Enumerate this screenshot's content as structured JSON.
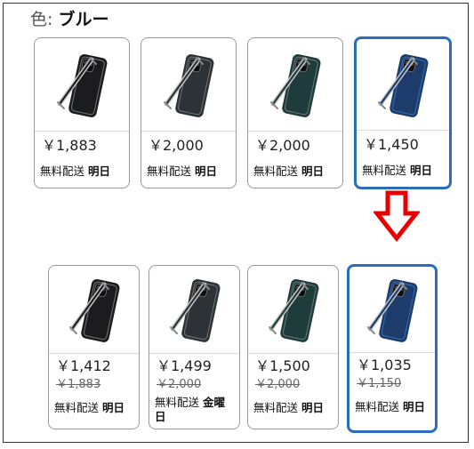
{
  "color_label": {
    "key": "色:",
    "value": "ブルー"
  },
  "phone_colors": {
    "black": "#1c1c1e",
    "graphite": "#2c3236",
    "teal": "#1f3c3d",
    "blue": "#1d3b6b",
    "blue_bright": "#2f6fb5"
  },
  "selected_border_color": "#2a6ebb",
  "arrow": {
    "icon": "down-arrow-icon",
    "color": "#e60000"
  },
  "top_row": [
    {
      "variant": "black",
      "price": "￥1,883",
      "ship_text": "無料配送",
      "ship_day": "明日"
    },
    {
      "variant": "graphite",
      "price": "￥2,000",
      "ship_text": "無料配送",
      "ship_day": "明日"
    },
    {
      "variant": "teal",
      "price": "￥2,000",
      "ship_text": "無料配送",
      "ship_day": "明日"
    },
    {
      "variant": "blue",
      "price": "￥1,450",
      "ship_text": "無料配送",
      "ship_day": "明日",
      "selected": true
    }
  ],
  "bottom_row": [
    {
      "variant": "black",
      "price": "￥1,412",
      "was": "￥1,883",
      "ship_text": "無料配送",
      "ship_day": "明日"
    },
    {
      "variant": "graphite",
      "price": "￥1,499",
      "was": "￥2,000",
      "ship_text": "無料配送",
      "ship_day": "金曜日"
    },
    {
      "variant": "teal",
      "price": "￥1,500",
      "was": "￥2,000",
      "ship_text": "無料配送",
      "ship_day": "明日"
    },
    {
      "variant": "blue",
      "price": "￥1,035",
      "was": "￥1,150",
      "ship_text": "無料配送",
      "ship_day": "明日",
      "selected": true
    }
  ]
}
